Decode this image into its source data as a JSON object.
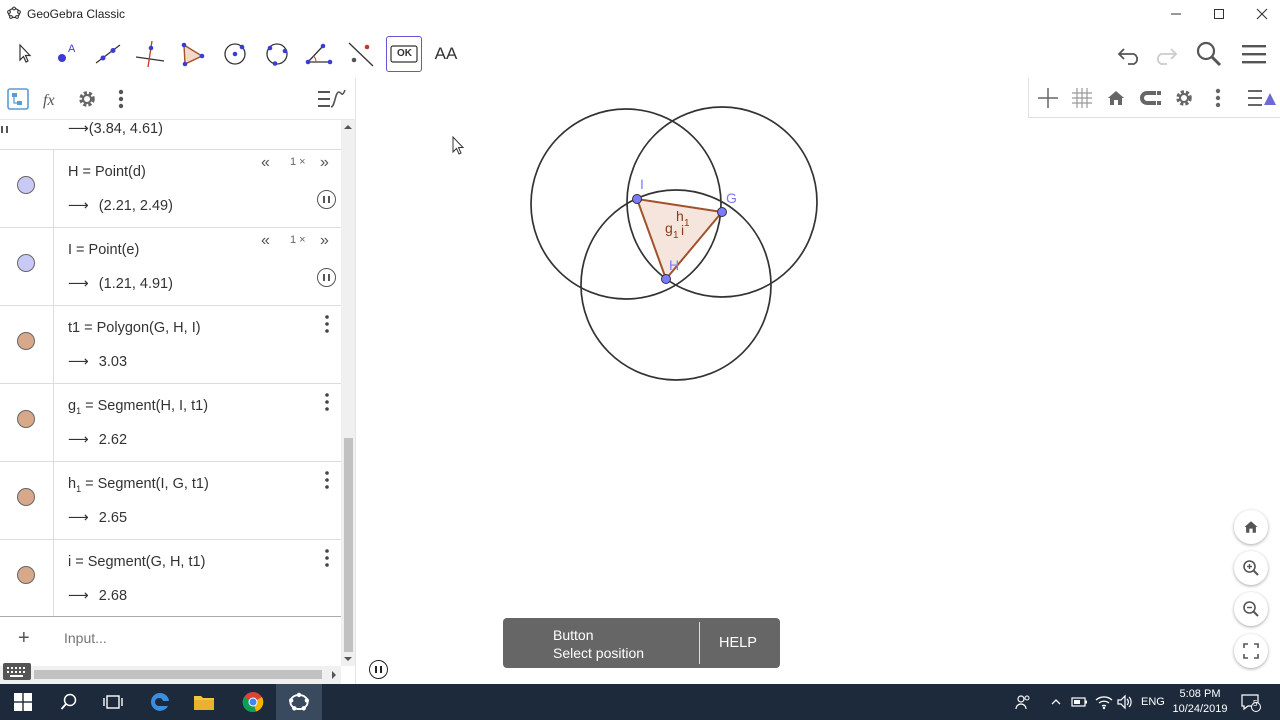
{
  "window": {
    "title": "GeoGebra Classic"
  },
  "algebra": {
    "top_value": "(3.84, 4.61)",
    "rows": [
      {
        "def": "H = Point(d)",
        "val": "(2.21, 2.49)",
        "color": "#c9c9f5",
        "speed": "1 ×",
        "kind": "animated"
      },
      {
        "def": "I = Point(e)",
        "val": "(1.21, 4.91)",
        "color": "#c9c9f5",
        "speed": "1 ×",
        "kind": "animated"
      },
      {
        "def": "t1 = Polygon(G, H, I)",
        "val": "3.03",
        "color": "#d8a88a",
        "kind": "static"
      },
      {
        "def_name": "g",
        "def_sub": "1",
        "def_rest": " = Segment(H, I, t1)",
        "val": "2.62",
        "color": "#d8a88a",
        "kind": "static"
      },
      {
        "def_name": "h",
        "def_sub": "1",
        "def_rest": " = Segment(I, G, t1)",
        "val": "2.65",
        "color": "#d8a88a",
        "kind": "static"
      },
      {
        "def": "i = Segment(G, H, t1)",
        "val": "2.68",
        "color": "#d8a88a",
        "kind": "static"
      }
    ],
    "input_placeholder": "Input...",
    "arrow": "⟶"
  },
  "graphics": {
    "labels": {
      "I": "I",
      "G": "G",
      "H": "H",
      "h1_main": "h",
      "h1_sub": "1",
      "g1_main": "g",
      "g1_sub": "1",
      "i": "i"
    },
    "colors": {
      "point": "#7b7bff",
      "segment": "#a0522d",
      "fill": "#f5e0d6",
      "circle": "#333333"
    }
  },
  "tooltip": {
    "line1": "Button",
    "line2": "Select position",
    "help": "HELP"
  },
  "toolbar": {
    "ok_label": "OK",
    "text_tool_label": "AA"
  },
  "taskbar": {
    "language": "ENG",
    "time": "5:08 PM",
    "date": "10/24/2019",
    "notifications": "5"
  }
}
